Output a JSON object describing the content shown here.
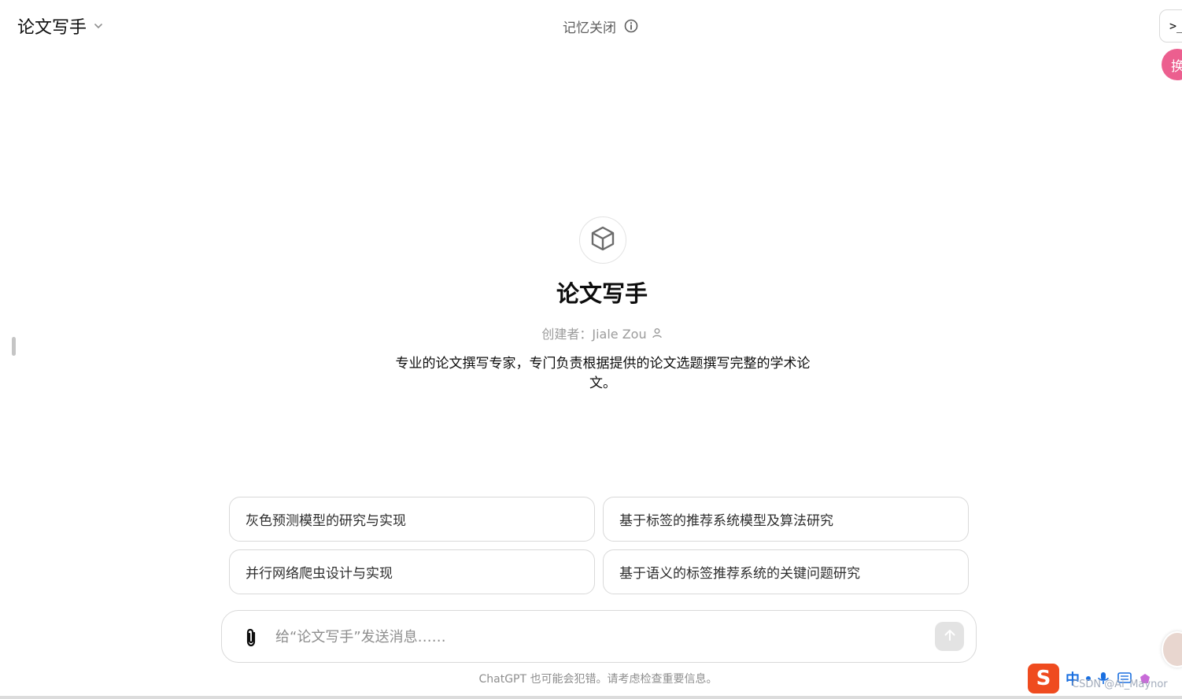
{
  "header": {
    "model_title": "论文写手",
    "memory_status": "记忆关闭",
    "terminal_label": ">_",
    "fab_label": "换"
  },
  "gpt": {
    "name": "论文写手",
    "creator": "创建者：Jiale Zou",
    "description": "专业的论文撰写专家，专门负责根据提供的论文选题撰写完整的学术论文。"
  },
  "suggestions": [
    {
      "label": "灰色预测模型的研究与实现"
    },
    {
      "label": "基于标签的推荐系统模型及算法研究"
    },
    {
      "label": "并行网络爬虫设计与实现"
    },
    {
      "label": "基于语义的标签推荐系统的关键问题研究"
    }
  ],
  "composer": {
    "placeholder": "给“论文写手”发送消息……"
  },
  "footer": {
    "disclaimer": "ChatGPT 也可能会犯错。请考虑检查重要信息。"
  },
  "overlay": {
    "ime_logo": "S",
    "ime_lang": "中",
    "watermark": "CSDN @Ai_Maynor"
  },
  "colors": {
    "border": "#d9d9d9",
    "text": "#0d0d0d",
    "muted": "#8e8e8e",
    "pink": "#ec5f8f"
  }
}
